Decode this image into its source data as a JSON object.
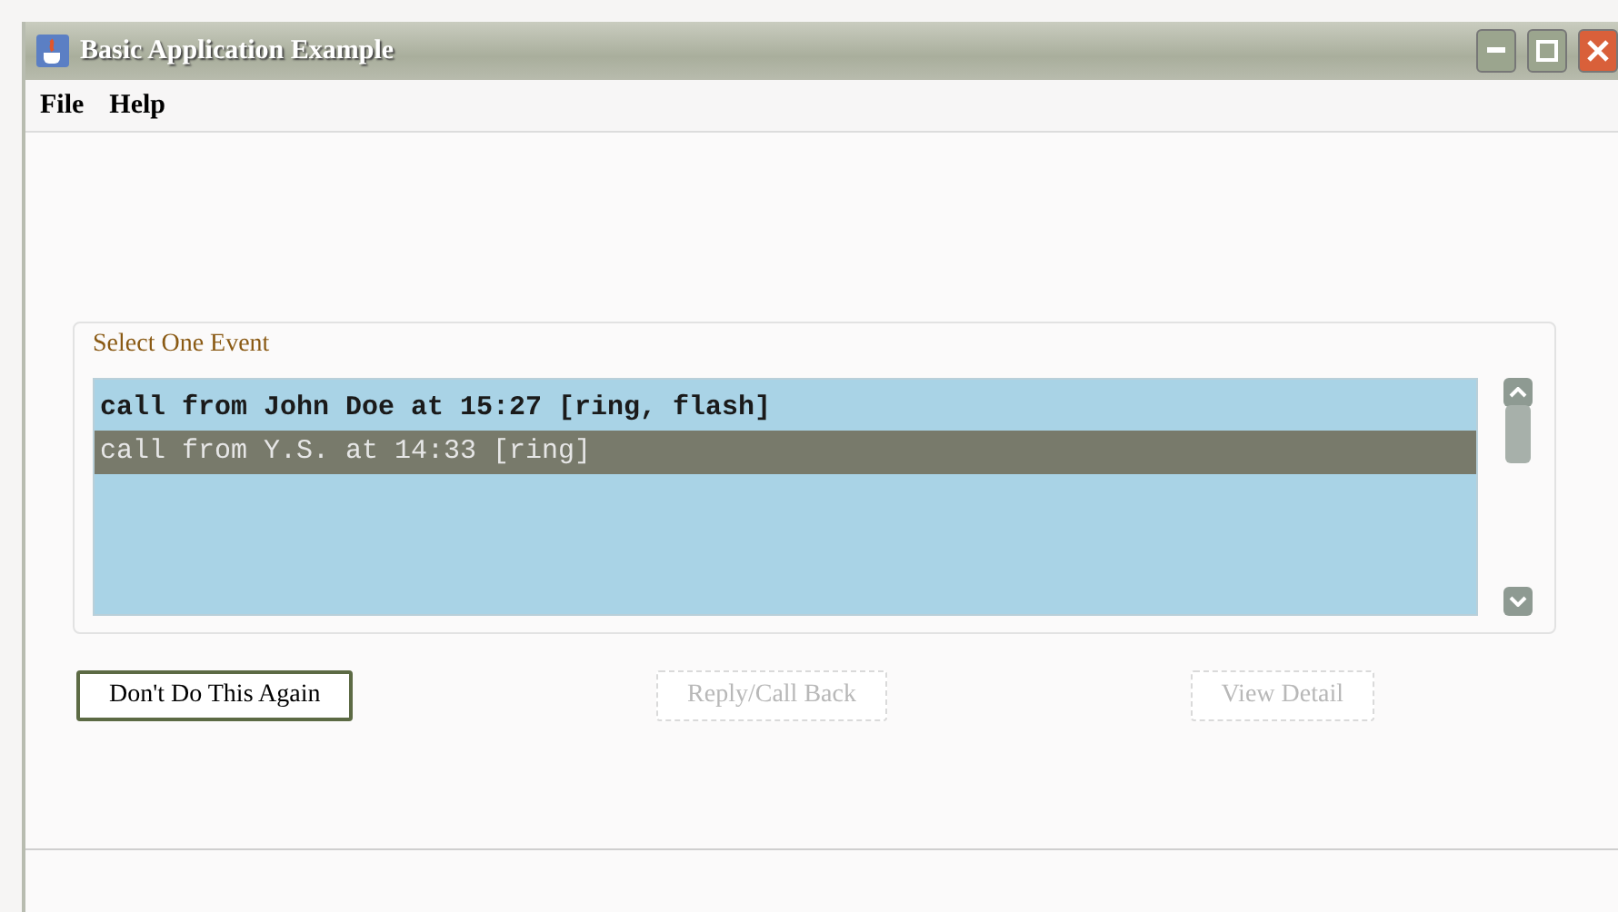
{
  "window": {
    "title": "Basic Application Example"
  },
  "menu": [
    "File",
    "Help"
  ],
  "event_group": {
    "title": "Select One Event",
    "items": [
      {
        "label": "call from John Doe at 15:27 [ring, flash]",
        "selected": false
      },
      {
        "label": "call from Y.S. at 14:33 [ring]",
        "selected": true
      }
    ]
  },
  "buttons": [
    {
      "label": "Don't Do This Again",
      "disabled": false
    },
    {
      "label": "Reply/Call Back",
      "disabled": true
    },
    {
      "label": "View Detail",
      "disabled": true
    }
  ]
}
